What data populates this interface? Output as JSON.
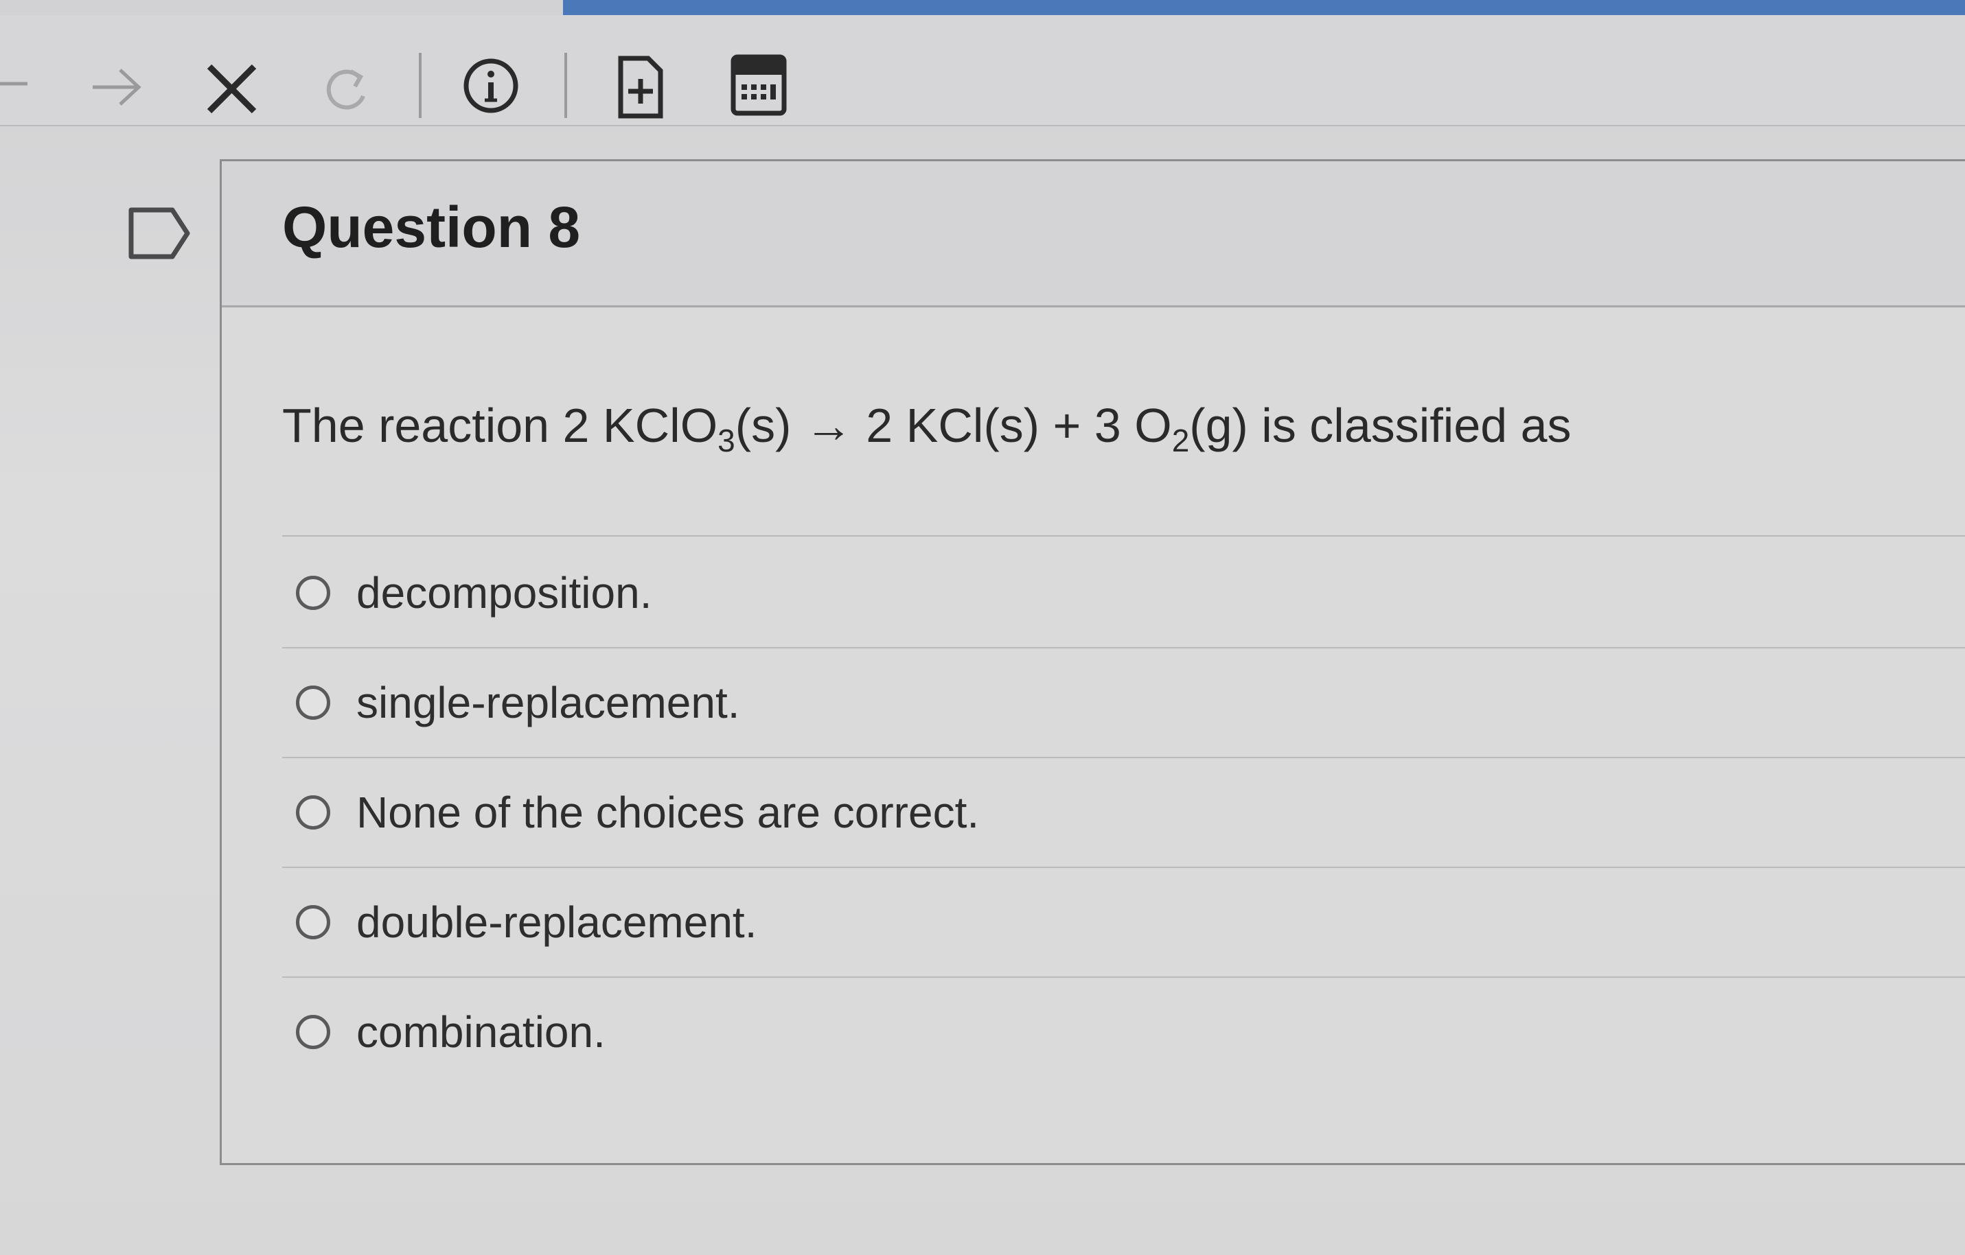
{
  "toolbar": {
    "icons": [
      "back-icon",
      "forward-icon",
      "close-icon",
      "reload-icon",
      "info-icon",
      "add-file-icon",
      "calculator-icon"
    ]
  },
  "question": {
    "title": "Question 8",
    "text_prefix": "The reaction 2 KClO",
    "sub1": "3",
    "part2": "(s) → 2 KCl(s) + 3 O",
    "sub2": "2",
    "part3": "(g) is classified as"
  },
  "options": [
    {
      "label": "decomposition."
    },
    {
      "label": "single-replacement."
    },
    {
      "label": "None of the choices are correct."
    },
    {
      "label": "double-replacement."
    },
    {
      "label": "combination."
    }
  ],
  "colors": {
    "accent_strip": "#4a78b8",
    "background": "#d8d8d9"
  }
}
